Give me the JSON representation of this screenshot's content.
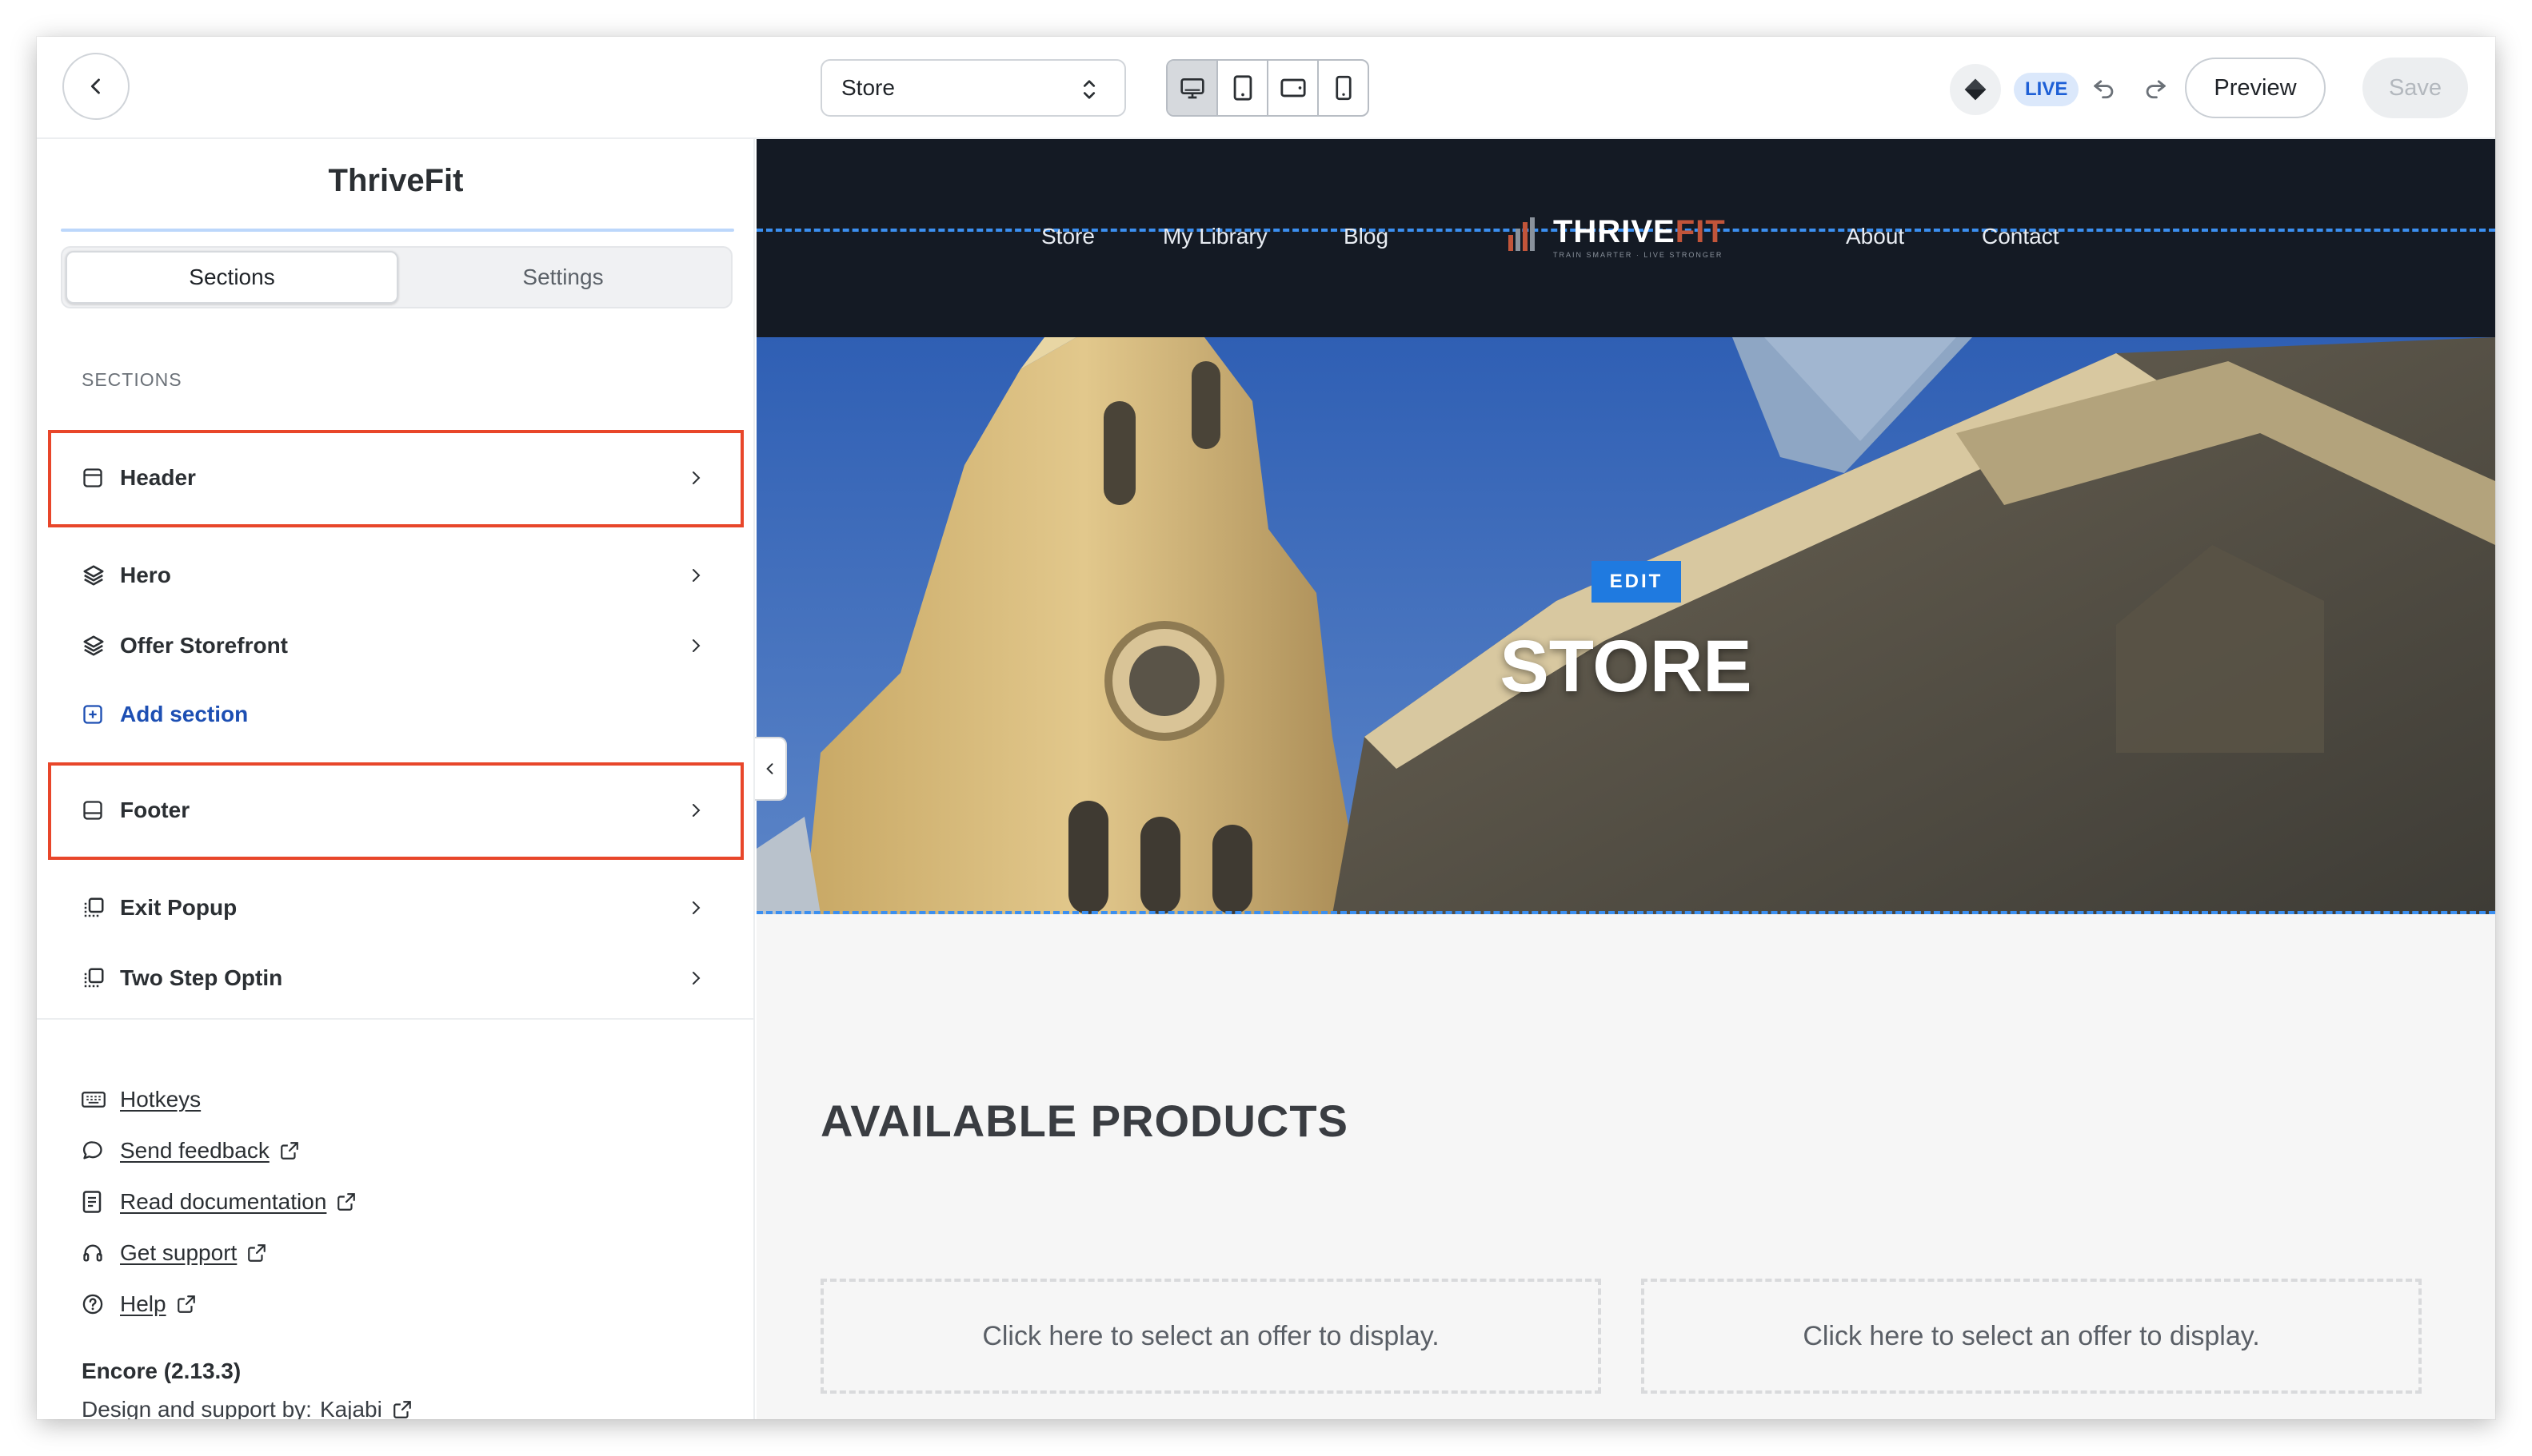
{
  "topbar": {
    "page_select_value": "Store",
    "live_badge": "LIVE",
    "preview_label": "Preview",
    "save_label": "Save"
  },
  "sidebar": {
    "site_name": "ThriveFit",
    "tabs": [
      {
        "label": "Sections",
        "active": true
      },
      {
        "label": "Settings",
        "active": false
      }
    ],
    "sections_heading": "SECTIONS",
    "sections": [
      {
        "label": "Header",
        "icon": "layout-top-icon",
        "highlighted": true
      },
      {
        "label": "Hero",
        "icon": "layers-icon"
      },
      {
        "label": "Offer Storefront",
        "icon": "layers-icon"
      }
    ],
    "add_section_label": "Add section",
    "global_sections": [
      {
        "label": "Footer",
        "icon": "layout-bottom-icon",
        "highlighted": true
      },
      {
        "label": "Exit Popup",
        "icon": "popup-icon"
      },
      {
        "label": "Two Step Optin",
        "icon": "popup-icon"
      }
    ],
    "links": [
      {
        "label": "Hotkeys",
        "icon": "keyboard-icon",
        "external": false
      },
      {
        "label": "Send feedback",
        "icon": "chat-icon",
        "external": true
      },
      {
        "label": "Read documentation",
        "icon": "document-icon",
        "external": true
      },
      {
        "label": "Get support",
        "icon": "headset-icon",
        "external": true
      },
      {
        "label": "Help",
        "icon": "help-circle-icon",
        "external": true
      }
    ],
    "version": "Encore (2.13.3)",
    "credit_prefix": "Design and support by:",
    "credit_link": "Kajabi"
  },
  "site": {
    "nav_left": [
      "Store",
      "My Library",
      "Blog"
    ],
    "nav_right": [
      "About",
      "Contact"
    ],
    "logo_main": "THRIVE",
    "logo_accent": "FIT",
    "logo_tagline": "TRAIN SMARTER · LIVE STRONGER",
    "edit_badge": "EDIT",
    "hero_title": "STORE",
    "products_title": "AVAILABLE PRODUCTS",
    "offer_placeholders": [
      "Click here to select an offer to display.",
      "Click here to select an offer to display."
    ]
  },
  "colors": {
    "accent_blue": "#3b8ff0",
    "highlight_red": "#e8462a",
    "site_header_bg": "#141a24",
    "live_badge_bg": "#dbe8fb"
  }
}
